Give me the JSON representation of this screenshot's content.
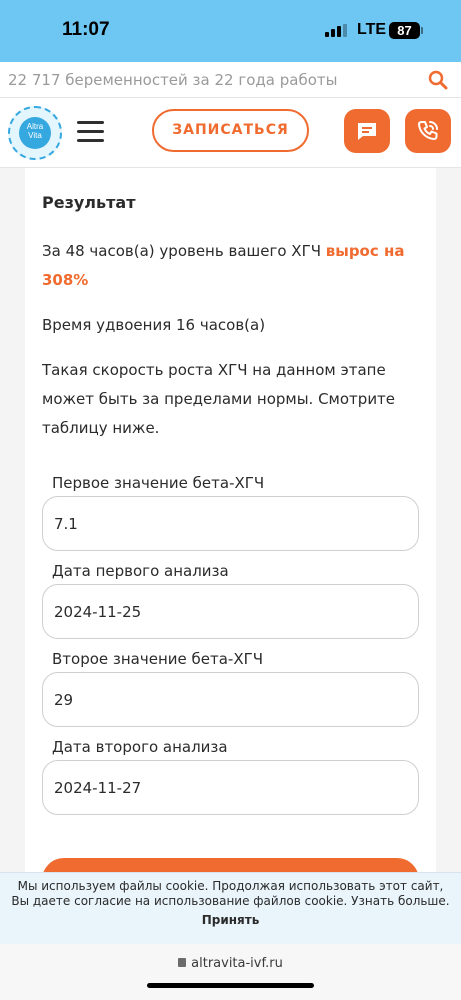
{
  "status_bar": {
    "time": "11:07",
    "network": "LTE",
    "battery": "87"
  },
  "search": {
    "text": "22 717 беременностей за 22 года работы"
  },
  "header": {
    "logo_line1": "Altra",
    "logo_line2": "Vita",
    "book_label": "ЗАПИСАТЬСЯ"
  },
  "result": {
    "title": "Результат",
    "line_prefix": "За 48 часов(а) уровень вашего ХГЧ ",
    "line_accent": "вырос на 308%",
    "doubling": "Время удвоения 16 часов(а)",
    "note": "Такая скорость роста ХГЧ на данном этапе может быть за пределами нормы. Смотрите таблицу ниже."
  },
  "form": {
    "first_value_label": "Первое значение бета-ХГЧ",
    "first_value": "7.1",
    "first_date_label": "Дата первого анализа",
    "first_date": "2024-11-25",
    "second_value_label": "Второе значение бета-ХГЧ",
    "second_value": "29",
    "second_date_label": "Дата второго анализа",
    "second_date": "2024-11-27"
  },
  "cookie": {
    "text": "Мы используем файлы cookie. Продолжая использовать этот сайт, Вы даете согласие на использование файлов cookie. Узнать больше.",
    "accept": "Принять"
  },
  "browser": {
    "url": "altravita-ivf.ru"
  },
  "colors": {
    "accent": "#f06b2f",
    "status_bar": "#6ec6f3",
    "logo_blue": "#35a8e0"
  },
  "icons": [
    "search-icon",
    "menu-icon",
    "chat-icon",
    "phone-icon",
    "lock-icon",
    "signal-icon",
    "battery-icon"
  ]
}
